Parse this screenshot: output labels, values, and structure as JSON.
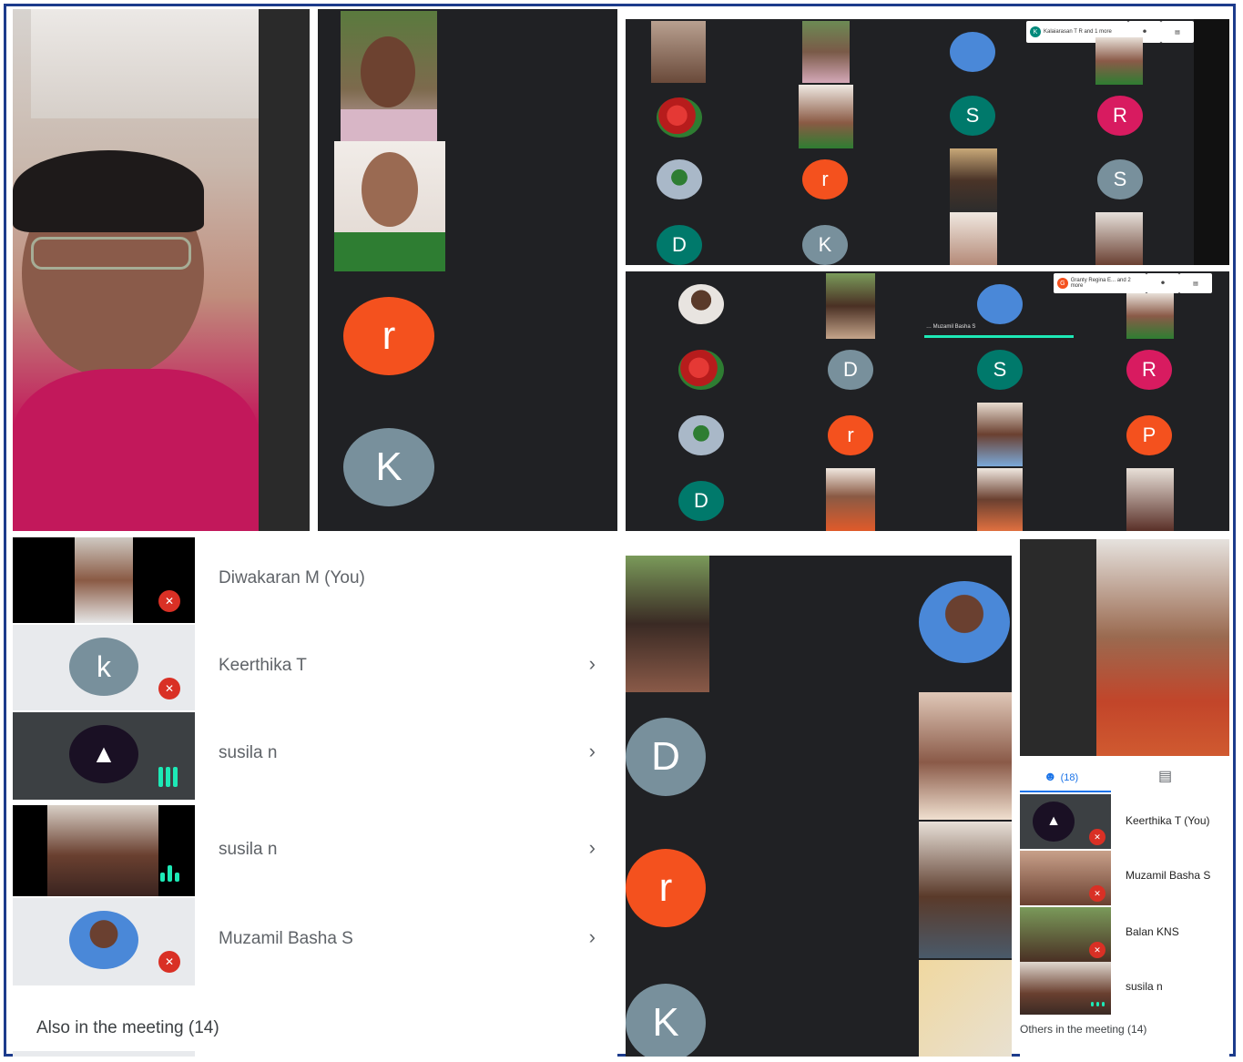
{
  "participants_list": {
    "items": [
      {
        "name": "Diwakaran M (You)"
      },
      {
        "name": "Keerthika T",
        "initial": "k"
      },
      {
        "name": "susila n"
      },
      {
        "name": "susila n"
      },
      {
        "name": "Muzamil Basha S"
      }
    ],
    "also_in_meeting": "Also in the meeting (14)"
  },
  "top_middle_panel": {
    "avatars": [
      {
        "initial": "r"
      },
      {
        "initial": "K"
      }
    ]
  },
  "grid_top": {
    "tag_initial": "K",
    "tag_text": "Kalaiarasan T R and 1 more",
    "avatars": [
      "S",
      "R",
      "r",
      "S",
      "D",
      "K"
    ]
  },
  "grid_bottom": {
    "tag_initial": "G",
    "tag_text": "Granty Regina E... and 2 more",
    "speaker_label": "Muzamil Basha S",
    "avatars": [
      "D",
      "S",
      "R",
      "r",
      "P",
      "D"
    ]
  },
  "bottom_middle_panel": {
    "avatars": [
      {
        "initial": "D"
      },
      {
        "initial": "r"
      },
      {
        "initial": "K"
      }
    ]
  },
  "side_list": {
    "people_count": "(18)",
    "items": [
      {
        "name": "Keerthika T (You)"
      },
      {
        "name": "Muzamil Basha S"
      },
      {
        "name": "Balan KNS"
      },
      {
        "name": "susila n"
      }
    ],
    "others": "Others in the meeting (14)"
  },
  "colors": {
    "frame": "#1c3b8c",
    "panel_bg": "#202124",
    "orange": "#f4511e",
    "grey": "#78909c",
    "teal": "#00796b",
    "pink": "#d81b60",
    "mute_red": "#d93025",
    "audio_bars": "#1de9b6"
  },
  "icons": [
    "mic-off-icon",
    "pin-icon",
    "chevron-right-icon",
    "people-icon",
    "chat-icon",
    "audio-level-icon"
  ]
}
